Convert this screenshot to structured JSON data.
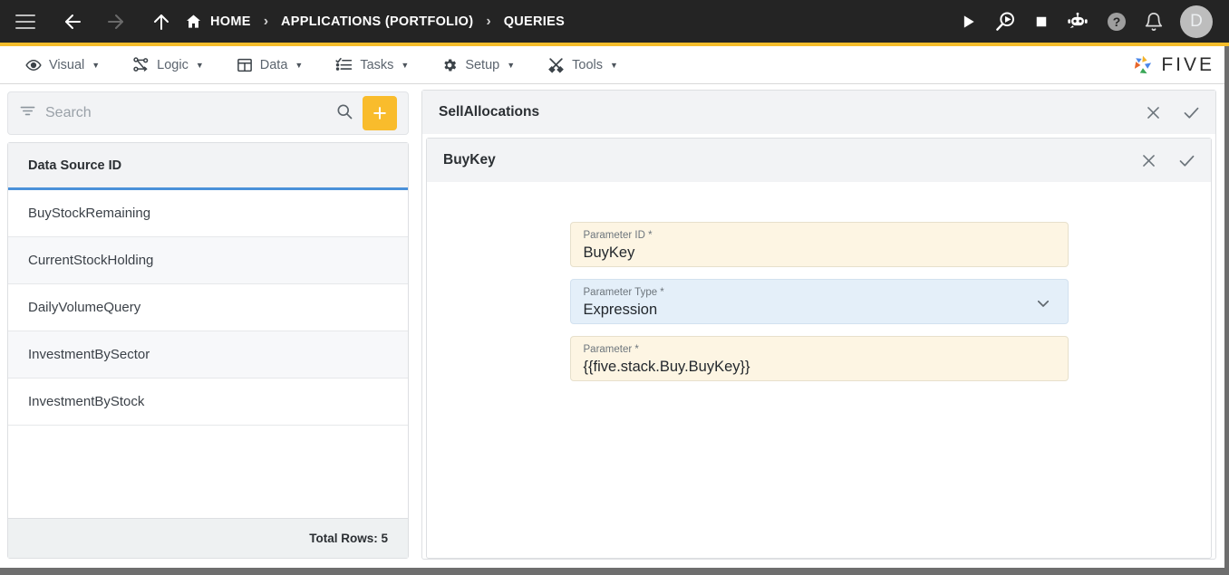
{
  "topbar": {
    "menu_icon": "hamburger-icon",
    "back_icon": "arrow-left-icon",
    "forward_icon": "arrow-right-icon",
    "up_icon": "arrow-up-icon",
    "home_icon": "home-icon",
    "breadcrumbs": [
      {
        "label": "HOME",
        "icon": "home-icon"
      },
      {
        "label": "APPLICATIONS (PORTFOLIO)",
        "icon": ""
      },
      {
        "label": "QUERIES",
        "icon": ""
      }
    ],
    "separator": "›",
    "actions": [
      {
        "name": "run-icon",
        "glyph": "▶"
      },
      {
        "name": "debug-icon",
        "glyph": ""
      },
      {
        "name": "stop-icon",
        "glyph": "■"
      },
      {
        "name": "chatbot-icon",
        "glyph": ""
      },
      {
        "name": "help-icon",
        "glyph": "?"
      },
      {
        "name": "notifications-bell-icon",
        "glyph": ""
      }
    ],
    "avatar_initial": "D",
    "accent_color": "#f5bd2b",
    "background_color": "#242424"
  },
  "menubar": {
    "items": [
      {
        "label": "Visual",
        "icon": "eye-icon"
      },
      {
        "label": "Logic",
        "icon": "flow-nodes-icon"
      },
      {
        "label": "Data",
        "icon": "table-grid-icon"
      },
      {
        "label": "Tasks",
        "icon": "checklist-icon"
      },
      {
        "label": "Setup",
        "icon": "gear-icon"
      },
      {
        "label": "Tools",
        "icon": "hammer-wrench-icon"
      }
    ],
    "caret": "▼",
    "brand": {
      "name": "five-logo-icon",
      "word": "FIVE"
    }
  },
  "sidebar": {
    "search": {
      "placeholder": "Search",
      "value": "",
      "filter_icon": "filter-icon",
      "search_icon": "search-icon"
    },
    "add_button": {
      "label": "+",
      "name": "add-record-button",
      "color": "#f9bc2c"
    },
    "table": {
      "column_header": "Data Source ID",
      "rows": [
        {
          "label": "BuyStockRemaining"
        },
        {
          "label": "CurrentStockHolding"
        },
        {
          "label": "DailyVolumeQuery"
        },
        {
          "label": "InvestmentBySector"
        },
        {
          "label": "InvestmentByStock"
        }
      ],
      "footer": "Total Rows: 5"
    }
  },
  "detail": {
    "outer_card": {
      "title": "SellAllocations",
      "close_icon": "close-icon",
      "confirm_icon": "check-icon"
    },
    "inner_card": {
      "title": "BuyKey",
      "close_icon": "close-icon",
      "confirm_icon": "check-icon"
    },
    "fields": [
      {
        "label": "Parameter ID *",
        "value": "BuyKey",
        "type": "text",
        "name": "parameter-id-field"
      },
      {
        "label": "Parameter Type *",
        "value": "Expression",
        "type": "select",
        "name": "parameter-type-select",
        "chevron": "chevron-down-icon"
      },
      {
        "label": "Parameter *",
        "value": "{{five.stack.Buy.BuyKey}}",
        "type": "text",
        "name": "parameter-value-field"
      }
    ]
  }
}
